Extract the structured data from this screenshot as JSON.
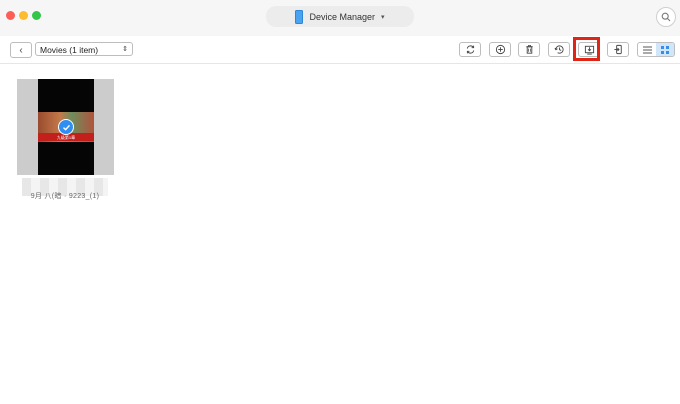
{
  "window": {
    "device_label": "Device Manager",
    "traffic_colors": {
      "close": "#fc5e57",
      "minimize": "#fcbc2e",
      "maximize": "#33c648"
    }
  },
  "toolbar": {
    "folder_select_value": "Movies (1 item)",
    "buttons": [
      {
        "name": "refresh",
        "icon": "refresh-icon"
      },
      {
        "name": "add",
        "icon": "plus-circle-icon"
      },
      {
        "name": "delete",
        "icon": "trash-icon"
      },
      {
        "name": "restore",
        "icon": "restore-icon"
      },
      {
        "name": "export-to-computer",
        "icon": "export-to-computer-icon",
        "highlighted": true
      },
      {
        "name": "send-to-device",
        "icon": "send-to-device-icon"
      }
    ],
    "view_modes": {
      "list": "list-view-icon",
      "grid": "grid-view-icon",
      "active": "grid"
    },
    "highlight_color": "#e02416"
  },
  "media": {
    "items": [
      {
        "caption": "九级第1章",
        "file_name": "9月 八(暗 · 9223_(1)",
        "selected": true
      }
    ]
  },
  "colors": {
    "accent": "#2f8ef0",
    "active_view_bg": "#cfe6fb"
  }
}
